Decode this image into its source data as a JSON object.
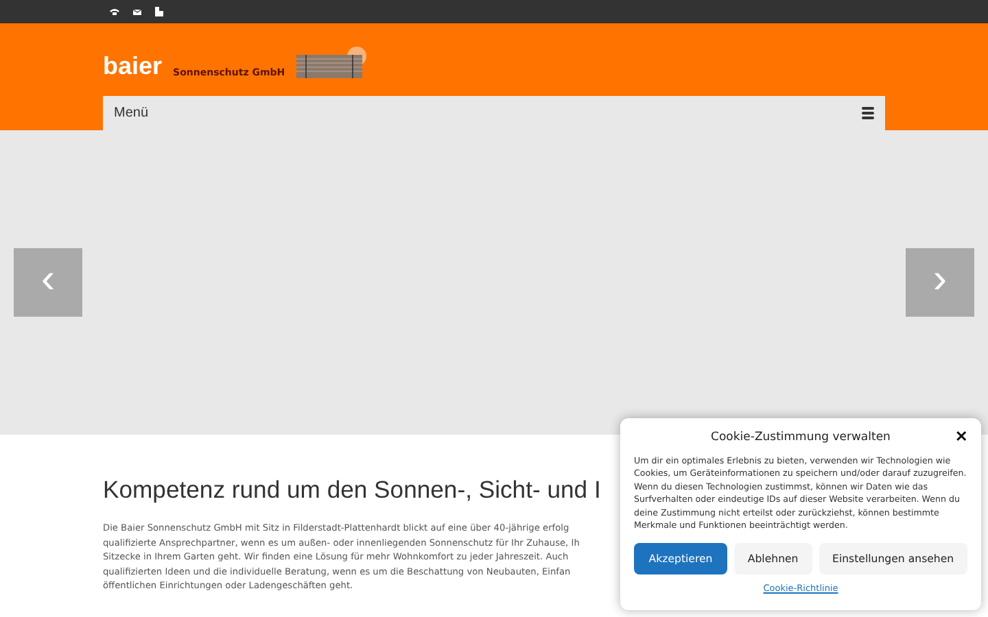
{
  "logo": {
    "name": "baier",
    "tagline": "Sonnenschutz GmbH"
  },
  "menu": {
    "label": "Menü"
  },
  "slider": {
    "prev": "‹",
    "next": "›"
  },
  "intro": {
    "heading": "Kompetenz rund um den Sonnen-, Sicht- und I",
    "lines": [
      "Die Baier Sonnenschutz GmbH mit Sitz in Filderstadt-Plattenhardt blickt auf eine über 40-jährige erfolg",
      "qualifizierte Ansprechpartner, wenn es um außen- oder innenliegenden Sonnenschutz für Ihr Zuhause, Ih",
      "Sitzecke in Ihrem Garten geht. Wir finden eine Lösung für mehr Wohnkomfort zu jeder Jahreszeit. Auch",
      "qualifizierten Ideen und die individuelle Beratung, wenn es um die Beschattung von Neubauten, Einfan",
      "öffentlichen Einrichtungen oder Ladengeschäften geht."
    ]
  },
  "cookie": {
    "title": "Cookie-Zustimmung verwalten",
    "close": "✕",
    "text": "Um dir ein optimales Erlebnis zu bieten, verwenden wir Technologien wie Cookies, um Geräteinformationen zu speichern und/oder darauf zuzugreifen. Wenn du diesen Technologien zustimmst, können wir Daten wie das Surfverhalten oder eindeutige IDs auf dieser Website verarbeiten. Wenn du deine Zustimmung nicht erteilst oder zurückziehst, können bestimmte Merkmale und Funktionen beeinträchtigt werden.",
    "buttons": [
      {
        "label": "Akzeptieren",
        "kind": "primary"
      },
      {
        "label": "Ablehnen",
        "kind": "secondary"
      },
      {
        "label": "Einstellungen ansehen",
        "kind": "secondary"
      }
    ],
    "link": "Cookie-Richtlinie"
  }
}
